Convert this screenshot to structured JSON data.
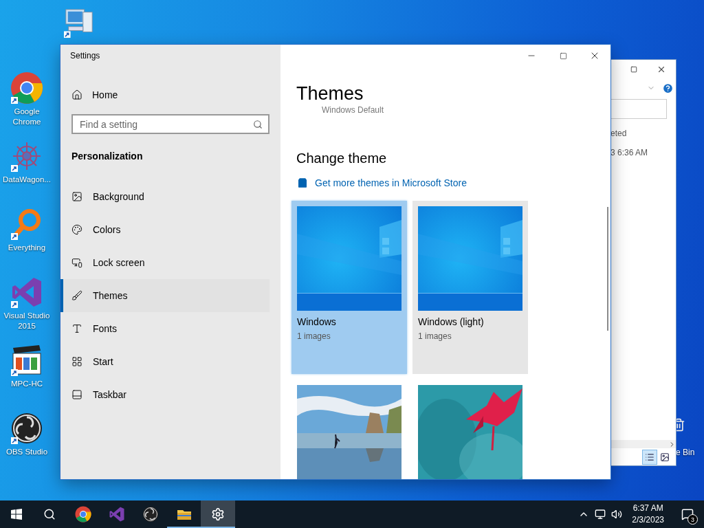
{
  "desktop_icons": [
    {
      "kind": "chrome",
      "label": "Google Chrome"
    },
    {
      "kind": "datawagon",
      "label": "DataWagon..."
    },
    {
      "kind": "everything",
      "label": "Everything"
    },
    {
      "kind": "visualstudio",
      "label": "Visual Studio 2015"
    },
    {
      "kind": "mpc",
      "label": "MPC-HC"
    },
    {
      "kind": "obs",
      "label": "OBS Studio"
    }
  ],
  "background_window": {
    "column_text": "eted",
    "date_text": "3 6:36 AM"
  },
  "recycle_bin": {
    "label": "e Bin"
  },
  "settings": {
    "title": "Settings",
    "home": "Home",
    "search": {
      "placeholder": "Find a setting"
    },
    "section": "Personalization",
    "nav": [
      {
        "kind": "background",
        "label": "Background",
        "selected": false
      },
      {
        "kind": "colors",
        "label": "Colors",
        "selected": false
      },
      {
        "kind": "lockscreen",
        "label": "Lock screen",
        "selected": false
      },
      {
        "kind": "themes",
        "label": "Themes",
        "selected": true
      },
      {
        "kind": "fonts",
        "label": "Fonts",
        "selected": false
      },
      {
        "kind": "start",
        "label": "Start",
        "selected": false
      },
      {
        "kind": "taskbar",
        "label": "Taskbar",
        "selected": false
      }
    ],
    "page_title": "Themes",
    "scrolled_text": "Windows Default",
    "change_theme": "Change theme",
    "store_link": "Get more themes in Microsoft Store",
    "themes": [
      {
        "kind": "windows",
        "name": "Windows",
        "count": "1 images",
        "selected": true
      },
      {
        "kind": "windows",
        "name": "Windows (light)",
        "count": "1 images",
        "selected": false
      },
      {
        "kind": "beach"
      },
      {
        "kind": "flower"
      }
    ]
  },
  "taskbar": {
    "apps": [
      {
        "kind": "start",
        "running": false,
        "active": false
      },
      {
        "kind": "search",
        "running": false,
        "active": false
      },
      {
        "kind": "chrome",
        "running": false,
        "active": false
      },
      {
        "kind": "visualstudio",
        "running": false,
        "active": false
      },
      {
        "kind": "obs",
        "running": false,
        "active": false
      },
      {
        "kind": "explorer",
        "running": true,
        "active": false
      },
      {
        "kind": "settings",
        "running": true,
        "active": true
      }
    ],
    "time": "6:37 AM",
    "date": "2/3/2023",
    "notifications": "3"
  }
}
